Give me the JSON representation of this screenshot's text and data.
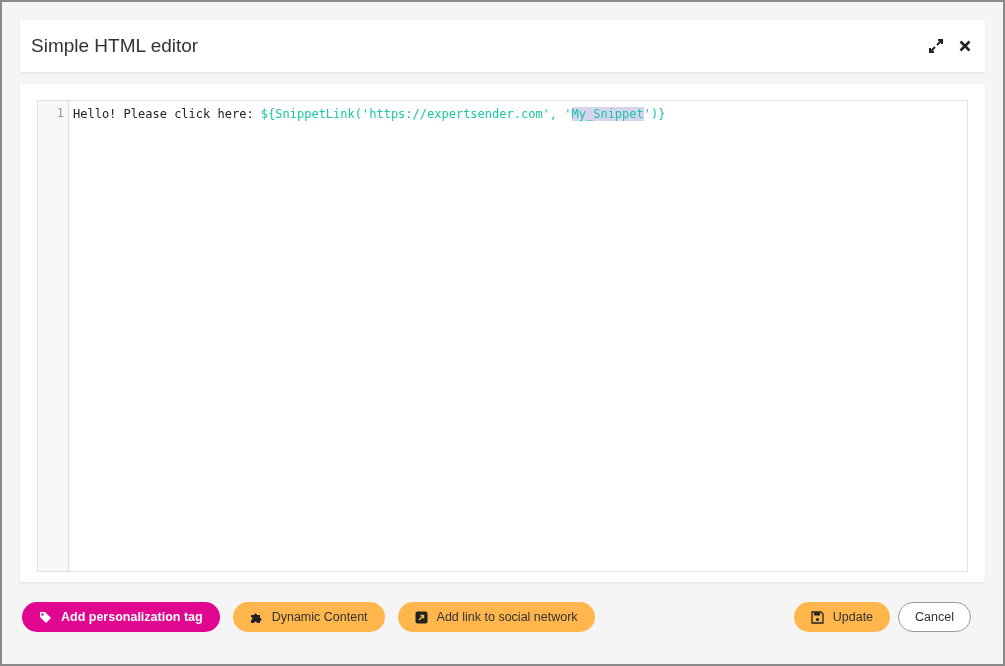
{
  "dialog": {
    "title": "Simple HTML editor"
  },
  "editor": {
    "lines": [
      {
        "number": "1",
        "segments": [
          {
            "kind": "text",
            "text": "Hello! Please click here: ",
            "selected": false
          },
          {
            "kind": "code",
            "text": "${SnippetLink('https://expertsender.com', '",
            "selected": false
          },
          {
            "kind": "code",
            "text": "My_Snippet",
            "selected": true
          },
          {
            "kind": "code",
            "text": "')}",
            "selected": false
          }
        ]
      }
    ]
  },
  "footer": {
    "left_buttons": [
      {
        "label": "Add personalization tag",
        "kind": "primary"
      },
      {
        "label": "Dynamic Content",
        "kind": "accent"
      },
      {
        "label": "Add link to social network",
        "kind": "accent"
      }
    ],
    "right_buttons": [
      {
        "label": "Update",
        "kind": "accent"
      },
      {
        "label": "Cancel",
        "kind": "outline"
      }
    ]
  }
}
